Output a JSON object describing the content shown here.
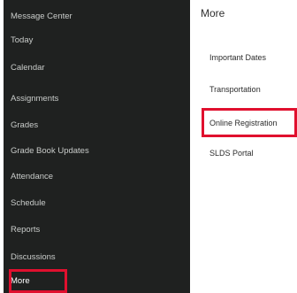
{
  "sidebar": {
    "items": [
      {
        "label": "Message Center"
      },
      {
        "label": "Today"
      },
      {
        "label": "Calendar"
      },
      {
        "label": "Assignments"
      },
      {
        "label": "Grades"
      },
      {
        "label": "Grade Book Updates"
      },
      {
        "label": "Attendance"
      },
      {
        "label": "Schedule"
      },
      {
        "label": "Reports"
      },
      {
        "label": "Discussions"
      },
      {
        "label": "More"
      }
    ],
    "selected": "More"
  },
  "main": {
    "title": "More",
    "links": [
      {
        "label": "Important Dates"
      },
      {
        "label": "Transportation"
      },
      {
        "label": "Online Registration"
      },
      {
        "label": "SLDS Portal"
      }
    ]
  },
  "colors": {
    "sidebar_bg": "#1f2120",
    "highlight": "#e0102e"
  }
}
